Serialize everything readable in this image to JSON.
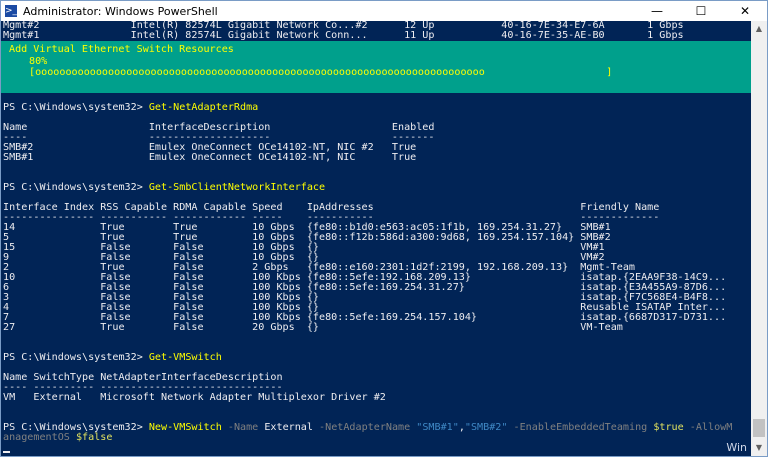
{
  "window": {
    "title": "Administrator: Windows PowerShell",
    "icon_label": ">_",
    "minimize_glyph": "—",
    "maximize_glyph": "☐",
    "close_glyph": "✕",
    "watermark": "Win"
  },
  "console": {
    "top_lines": [
      "Mgmt#2               Intel(R) 82574L Gigabit Network Co...#2      12 Up           40-16-7E-34-E7-6A       1 Gbps",
      "Mgmt#1               Intel(R) 82574L Gigabit Network Conn...      11 Up           40-16-7E-35-AE-B0       1 Gbps"
    ],
    "progress": {
      "title": "Add Virtual Ethernet Switch Resources",
      "percent": "80%",
      "bar": "[oooooooooooooooooooooooooooooooooooooooooooooooooooooooooooooooooooooooooo                    ]",
      "value": 0.8
    },
    "blank": "",
    "prompt": "PS C:\\Windows\\system32> ",
    "cmd1": "Get-NetAdapterRdma",
    "rdma_table": [
      "Name                    InterfaceDescription                    Enabled",
      "----                    --------------------                    -------",
      "SMB#2                   Emulex OneConnect OCe14102-NT, NIC #2   True",
      "SMB#1                   Emulex OneConnect OCe14102-NT, NIC      True"
    ],
    "cmd2": "Get-SmbClientNetworkInterface",
    "smb_table": [
      "Interface Index RSS Capable RDMA Capable Speed    IpAddresses                                  Friendly Name",
      "--------------- ----------- ------------ -----    -----------                                  -------------",
      "14              True        True         10 Gbps  {fe80::b1d0:e563:ac05:1f1b, 169.254.31.27}   SMB#1",
      "5               True        True         10 Gbps  {fe80::f12b:586d:a300:9d68, 169.254.157.104} SMB#2",
      "15              False       False        10 Gbps  {}                                           VM#1",
      "9               False       False        10 Gbps  {}                                           VM#2",
      "2               True        False        2 Gbps   {fe80::e160:2301:1d2f:2199, 192.168.209.13}  Mgmt-Team",
      "10              False       False        100 Kbps {fe80::5efe:192.168.209.13}                  isatap.{2EAA9F38-14C9...",
      "6               False       False        100 Kbps {fe80::5efe:169.254.31.27}                   isatap.{E3A455A9-87D6...",
      "3               False       False        100 Kbps {}                                           isatap.{F7C568E4-B4F8...",
      "4               False       False        100 Kbps {}                                           Reusable ISATAP Inter...",
      "7               False       False        100 Kbps {fe80::5efe:169.254.157.104}                 isatap.{6687D317-D731...",
      "27              True        False        20 Gbps  {}                                           VM-Team"
    ],
    "cmd3": "Get-VMSwitch",
    "vmswitch_table": [
      "Name SwitchType NetAdapterInterfaceDescription",
      "---- ---------- ------------------------------",
      "VM   External   Microsoft Network Adapter Multiplexor Driver #2"
    ],
    "cmd4": {
      "cmdlet": "New-VMSwitch",
      "p_name": " -Name ",
      "v_name": "External",
      "p_adapter": " -NetAdapterName ",
      "v_adapter1": "\"SMB#1\"",
      "comma": ",",
      "v_adapter2": "\"SMB#2\"",
      "p_team": " -EnableEmbeddedTeaming ",
      "v_team": "$true",
      "p_allow": " -AllowM",
      "wrap_text": "anagementOS ",
      "v_allow": "$false"
    }
  }
}
